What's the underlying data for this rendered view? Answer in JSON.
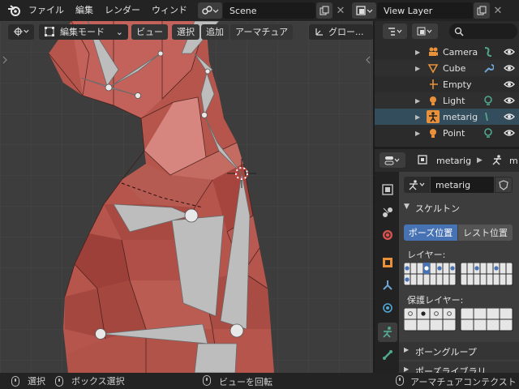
{
  "topbar": {
    "menus": [
      "ファイル",
      "編集",
      "レンダー",
      "ウィンド"
    ],
    "scene_name": "Scene",
    "view_layer": "View Layer"
  },
  "viewport_header": {
    "mode": "編集モード",
    "view": "ビュー",
    "select": "選択",
    "add": "追加",
    "armature": "アーマチュア",
    "transform_orientation": "グロー..."
  },
  "outliner": {
    "items": [
      {
        "label": "Camera",
        "icon": "camera-icon"
      },
      {
        "label": "Cube",
        "icon": "mesh-icon"
      },
      {
        "label": "Empty",
        "icon": "empty-icon"
      },
      {
        "label": "Light",
        "icon": "light-icon"
      },
      {
        "label": "metarig",
        "icon": "armature-icon"
      },
      {
        "label": "Point",
        "icon": "light-icon"
      }
    ]
  },
  "properties": {
    "breadcrumb": "metarig",
    "breadcrumb_cut": "m",
    "data_name": "metarig",
    "skeleton_panel": "スケルトン",
    "pose_position": "ポーズ位置",
    "rest_position": "レスト位置",
    "layers_label": "レイヤー:",
    "protected_layers_label": "保護レイヤー:",
    "bone_groups_panel": "ボーングループ",
    "pose_library_panel": "ポーズライブラリ"
  },
  "statusbar": {
    "select": "選択",
    "box_select": "ボックス選択",
    "rotate_view": "ビューを回転",
    "context_menu": "アーマチュアコンテクスト"
  },
  "colors": {
    "accent_blue": "#4772b3",
    "selection_row": "#334d5c",
    "mesh_red": "#b5554c",
    "bone_gray": "#b8b8b8"
  }
}
